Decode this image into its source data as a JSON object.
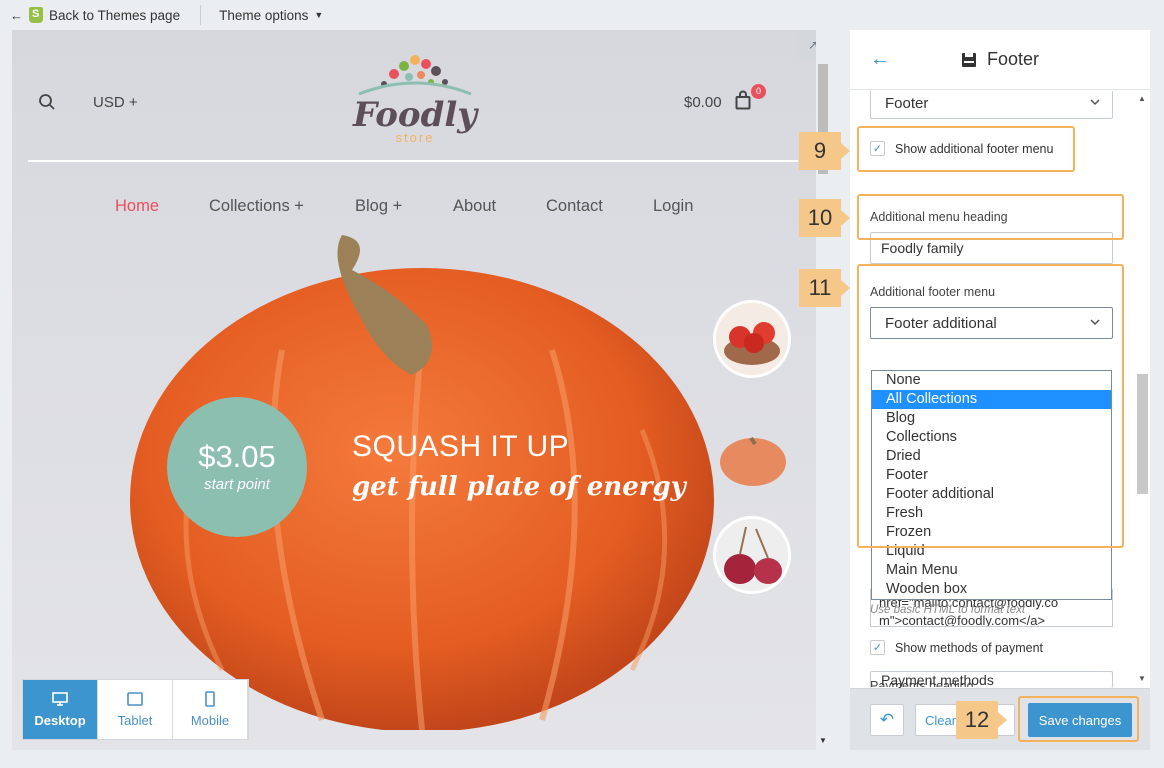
{
  "topbar": {
    "back_label": "Back to Themes page",
    "theme_options_label": "Theme options"
  },
  "store": {
    "currency": "USD",
    "currency_suffix": "+",
    "logo_text_1": "Foodly",
    "logo_text_2": "store",
    "cart_amount": "$0.00",
    "cart_count": "0",
    "nav": [
      {
        "label": "Home"
      },
      {
        "label": "Collections +"
      },
      {
        "label": "Blog +"
      },
      {
        "label": "About"
      },
      {
        "label": "Contact"
      },
      {
        "label": "Login"
      }
    ],
    "hero": {
      "price": "$3.05",
      "price_sub": "start point",
      "heading": "SQUASH IT UP",
      "subheading": "get full plate of energy"
    }
  },
  "devices": [
    {
      "label": "Desktop",
      "active": true
    },
    {
      "label": "Tablet",
      "active": false
    },
    {
      "label": "Mobile",
      "active": false
    }
  ],
  "panel": {
    "title": "Footer",
    "top_select_value": "Footer",
    "show_additional_label": "Show additional footer menu",
    "additional_heading_label": "Additional menu heading",
    "additional_heading_value": "Foodly family",
    "additional_menu_label": "Additional footer menu",
    "additional_menu_value": "Footer additional",
    "dropdown_options": [
      "None",
      "All Collections",
      "Blog",
      "Collections",
      "Dried",
      "Footer",
      "Footer additional",
      "Fresh",
      "Frozen",
      "Liquid",
      "Main Menu",
      "Wooden box"
    ],
    "dropdown_highlight": "All Collections",
    "textarea_line1": "href=\"mailto:contact@foodly.co",
    "textarea_line2": "m\">contact@foodly.com</a>",
    "help_text": "Use basic HTML to format text",
    "show_payment_label": "Show methods of payment",
    "payments_heading_label": "Payments heading",
    "payments_heading_value": "Payment methods"
  },
  "footer": {
    "clear_label": "Clear",
    "save_label": "Save changes"
  },
  "callouts": [
    "9",
    "10",
    "11",
    "12"
  ],
  "colors": {
    "accent": "#3d95d0",
    "callout": "#f5c88a",
    "callout_border": "#f5b25b",
    "price_circle": "#8cbfb0",
    "nav_active": "#e8505b"
  }
}
